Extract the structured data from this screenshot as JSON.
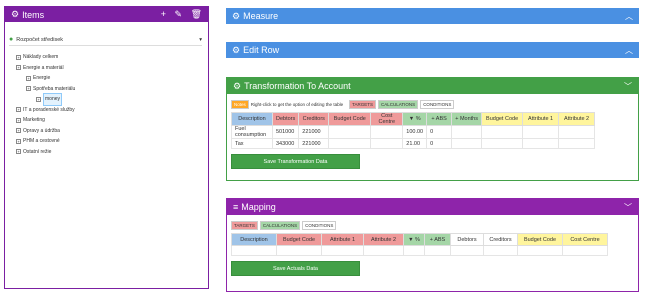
{
  "items": {
    "title": "Items",
    "selected": "Rozpočet středisek",
    "tree": [
      {
        "label": "Náklady celkem",
        "depth": 0
      },
      {
        "label": "Energie a materiál",
        "depth": 0
      },
      {
        "label": "Energie",
        "depth": 1
      },
      {
        "label": "Spotřeba materiálu",
        "depth": 1
      },
      {
        "label": "money",
        "depth": 2,
        "selected": true
      },
      {
        "label": "IT a poradenské služby",
        "depth": 0
      },
      {
        "label": "Marketing",
        "depth": 0
      },
      {
        "label": "Opravy a údržba",
        "depth": 0
      },
      {
        "label": "PHM a cestovné",
        "depth": 0
      },
      {
        "label": "Ostatní režie",
        "depth": 0
      }
    ]
  },
  "measure": {
    "title": "Measure"
  },
  "editrow": {
    "title": "Edit Row"
  },
  "transform": {
    "title": "Transformation To Account",
    "notes_tag": "Notes",
    "hint": "Right-click to get the option of editing the table",
    "tags": [
      "TARGETS",
      "CALCULATIONS",
      "CONDITIONS"
    ],
    "headers": [
      "Description",
      "Debtors",
      "Creditors",
      "Budget Code",
      "Cost Centre",
      "▼ %",
      "+ ABS",
      "+ Months",
      "Budget Code",
      "Attribute 1",
      "Attribute 2"
    ],
    "rows": [
      [
        "Fuel consumption",
        "501000",
        "221000",
        "",
        "",
        "100.00",
        "0",
        "",
        "",
        "",
        ""
      ],
      [
        "Tax",
        "343000",
        "221000",
        "",
        "",
        "21.00",
        "0",
        "",
        "",
        "",
        ""
      ]
    ],
    "button": "Save Transformation Data"
  },
  "mapping": {
    "title": "Mapping",
    "tags": [
      "TARGETS",
      "CALCULATIONS",
      "CONDITIONS"
    ],
    "headers": [
      "Description",
      "Budget Code",
      "Attribute 1",
      "Attribute 2",
      "▼ %",
      "+ ABS",
      "Debtors",
      "Creditors",
      "Budget Code",
      "Cost Centre"
    ],
    "button": "Save Actuals Data"
  },
  "colors": {
    "purple": "#7b1fa2",
    "blue": "#4a90e2",
    "green": "#43a047"
  }
}
